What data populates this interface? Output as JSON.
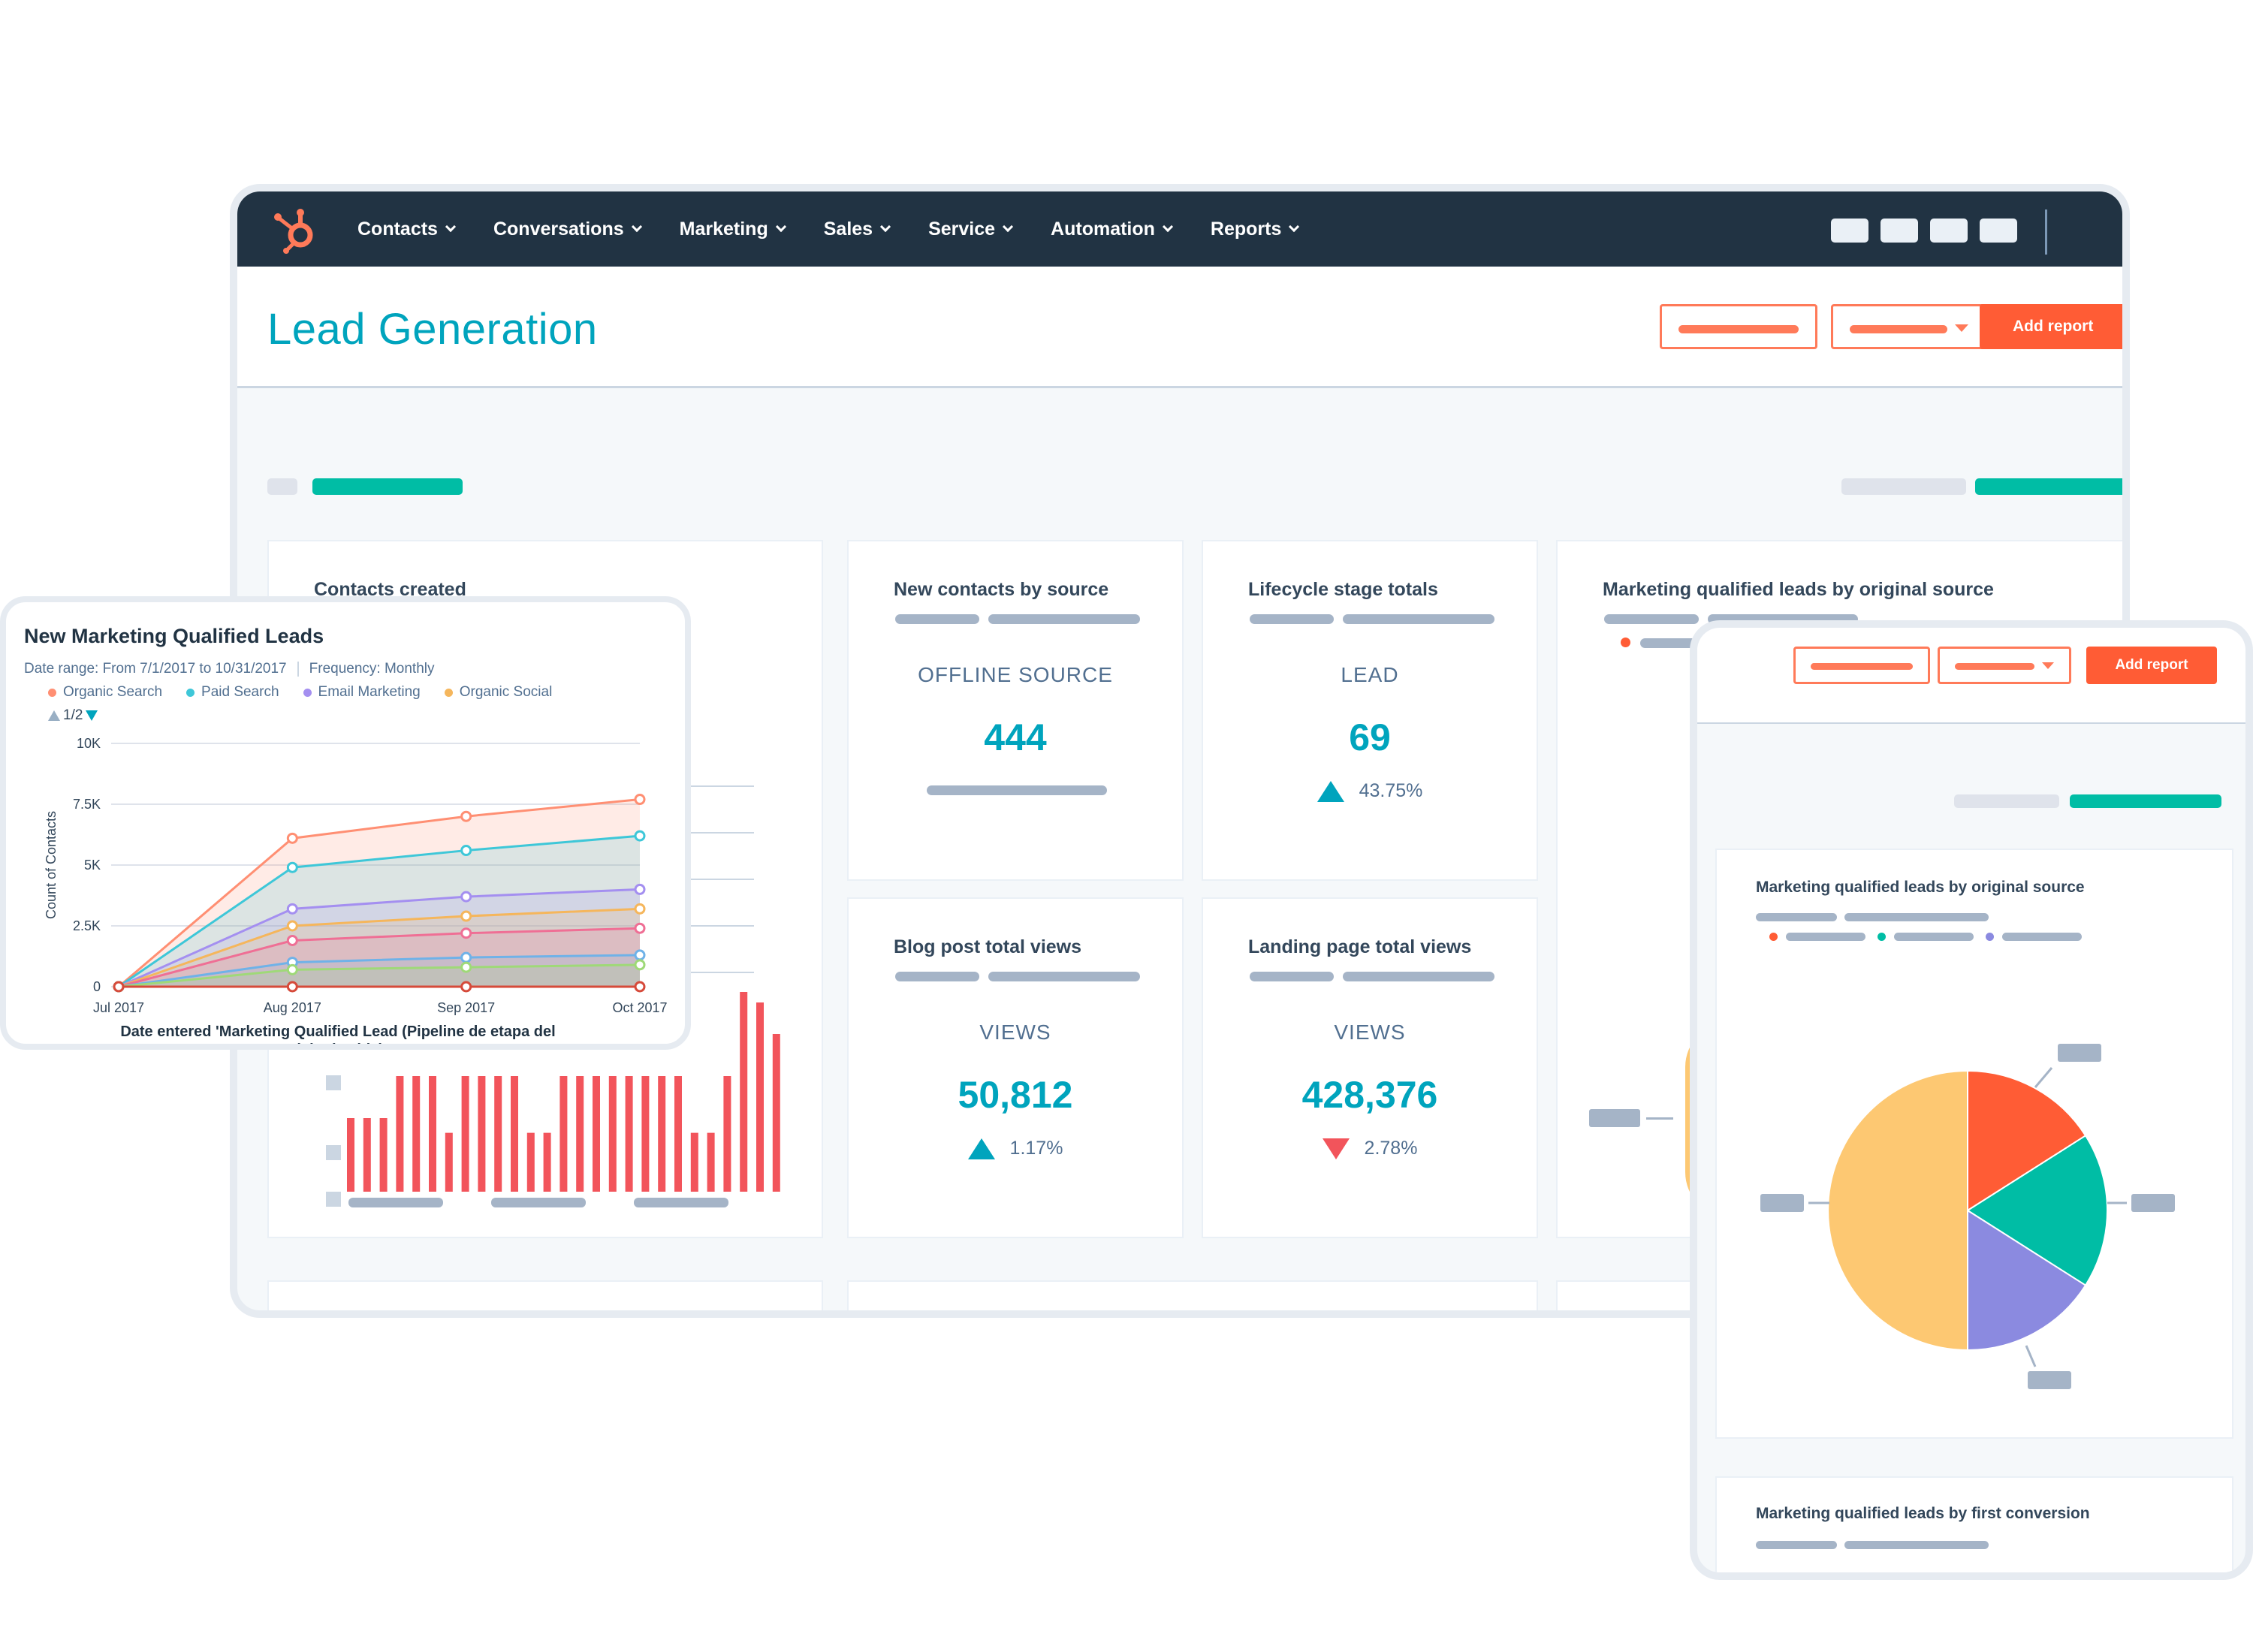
{
  "nav": {
    "items": [
      "Contacts",
      "Conversations",
      "Marketing",
      "Sales",
      "Service",
      "Automation",
      "Reports"
    ]
  },
  "header": {
    "title": "Lead Generation",
    "add_report_label": "Add report"
  },
  "cards": {
    "contacts_created": {
      "title": "Contacts created"
    },
    "new_contacts": {
      "title": "New contacts by source",
      "label": "OFFLINE SOURCE",
      "value": "444"
    },
    "lifecycle": {
      "title": "Lifecycle stage totals",
      "label": "LEAD",
      "value": "69",
      "delta": "43.75%",
      "direction": "up"
    },
    "mql_source": {
      "title": "Marketing qualified leads by original source"
    },
    "blog_views": {
      "title": "Blog post total views",
      "label": "VIEWS",
      "value": "50,812",
      "delta": "1.17%",
      "direction": "up"
    },
    "landing_views": {
      "title": "Landing page total views",
      "label": "VIEWS",
      "value": "428,376",
      "delta": "2.78%",
      "direction": "down"
    }
  },
  "overlay": {
    "title": "New Marketing Qualified Leads",
    "date_range": "Date range: From 7/1/2017 to 10/31/2017",
    "frequency": "Frequency: Monthly",
    "legend": [
      {
        "name": "Organic Search",
        "color": "#ff8f73"
      },
      {
        "name": "Paid Search",
        "color": "#3ec7d8"
      },
      {
        "name": "Email Marketing",
        "color": "#a48ff0"
      },
      {
        "name": "Organic Social",
        "color": "#f5b65c"
      }
    ],
    "pager": "1/2"
  },
  "chart_data": [
    {
      "type": "area",
      "title": "New Marketing Qualified Leads",
      "xlabel": "Date entered 'Marketing Qualified Lead (Pipeline de etapa del ciclo de vida)'",
      "ylabel": "Count of Contacts",
      "x": [
        "Jul 2017",
        "Aug 2017",
        "Sep 2017",
        "Oct 2017"
      ],
      "yticks": [
        "0",
        "2.5K",
        "5K",
        "7.5K",
        "10K"
      ],
      "ylim": [
        0,
        10000
      ],
      "grid": true,
      "series": [
        {
          "name": "Organic Search",
          "color": "#ff8f73",
          "values": [
            0,
            6100,
            7000,
            7700
          ]
        },
        {
          "name": "Paid Search",
          "color": "#3ec7d8",
          "values": [
            0,
            4900,
            5600,
            6200
          ]
        },
        {
          "name": "Email Marketing",
          "color": "#a48ff0",
          "values": [
            0,
            3200,
            3700,
            4000
          ]
        },
        {
          "name": "Organic Social",
          "color": "#f5b65c",
          "values": [
            0,
            2500,
            2900,
            3200
          ]
        },
        {
          "color": "#ef6f95",
          "values": [
            0,
            1900,
            2200,
            2400
          ]
        },
        {
          "color": "#6fb2e8",
          "values": [
            0,
            1000,
            1200,
            1300
          ]
        },
        {
          "color": "#9fd978",
          "values": [
            0,
            700,
            800,
            900
          ]
        },
        {
          "color": "#d64a3a",
          "values": [
            0,
            0,
            0,
            0
          ]
        }
      ]
    },
    {
      "type": "bar",
      "values": [
        0.35,
        0.35,
        0.35,
        0.55,
        0.55,
        0.55,
        0.28,
        0.55,
        0.55,
        0.55,
        0.55,
        0.28,
        0.28,
        0.55,
        0.55,
        0.55,
        0.55,
        0.55,
        0.55,
        0.55,
        0.55,
        0.28,
        0.28,
        0.55,
        0.95,
        0.9,
        0.75
      ]
    },
    {
      "type": "pie",
      "title": "Marketing qualified leads by original source",
      "values": [
        0.5,
        0.16,
        0.18,
        0.16
      ],
      "colors": [
        "#fdc872",
        "#ff5c35",
        "#00bda5",
        "#8b8ae0"
      ]
    }
  ],
  "tablet": {
    "add_report_label": "Add report",
    "card1_title": "Marketing qualified leads by original source",
    "card2_title": "Marketing qualified leads by first conversion"
  },
  "colors": {
    "nav_bg": "#213343",
    "accent_teal": "#00a4bd",
    "accent_orange": "#ff5c35",
    "bar_red": "#f2545b"
  }
}
